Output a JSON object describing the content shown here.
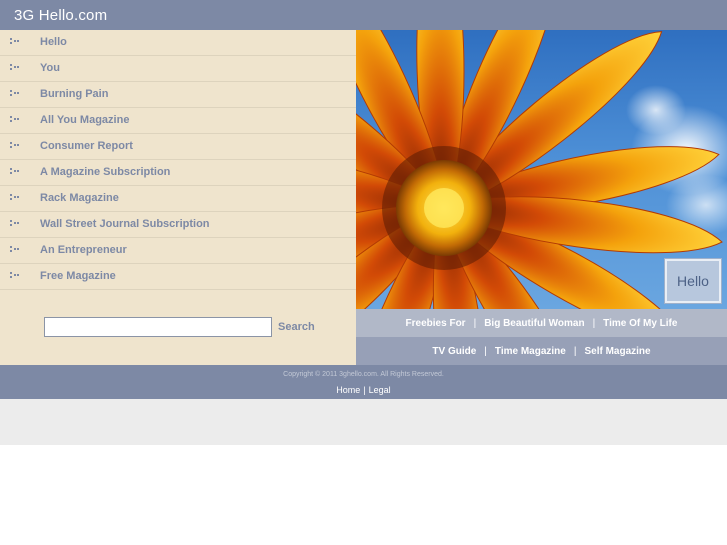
{
  "header": {
    "title": "3G Hello.com"
  },
  "sidebar": {
    "items": [
      {
        "label": "Hello"
      },
      {
        "label": "You"
      },
      {
        "label": "Burning Pain"
      },
      {
        "label": "All You Magazine"
      },
      {
        "label": "Consumer Report"
      },
      {
        "label": "A Magazine Subscription"
      },
      {
        "label": "Rack Magazine"
      },
      {
        "label": "Wall Street Journal Subscription"
      },
      {
        "label": "An Entrepreneur"
      },
      {
        "label": "Free Magazine"
      }
    ]
  },
  "search": {
    "value": "",
    "button_label": "Search"
  },
  "hero": {
    "badge_text": "Hello"
  },
  "links_row1": [
    {
      "label": "Freebies For"
    },
    {
      "label": "Big Beautiful Woman"
    },
    {
      "label": "Time Of My Life"
    }
  ],
  "links_row2": [
    {
      "label": "TV Guide"
    },
    {
      "label": "Time Magazine"
    },
    {
      "label": "Self Magazine"
    }
  ],
  "separator": "|",
  "footer": {
    "copyright": "Copyright © 2011 3ghello.com. All Rights Reserved.",
    "home_label": "Home",
    "legal_label": "Legal"
  },
  "colors": {
    "header": "#7d89a5",
    "sidebar": "#efe4cd",
    "link_text": "#7d89a5",
    "linkbar_1": "#b1b8c8",
    "linkbar_2": "#97a0b7"
  }
}
